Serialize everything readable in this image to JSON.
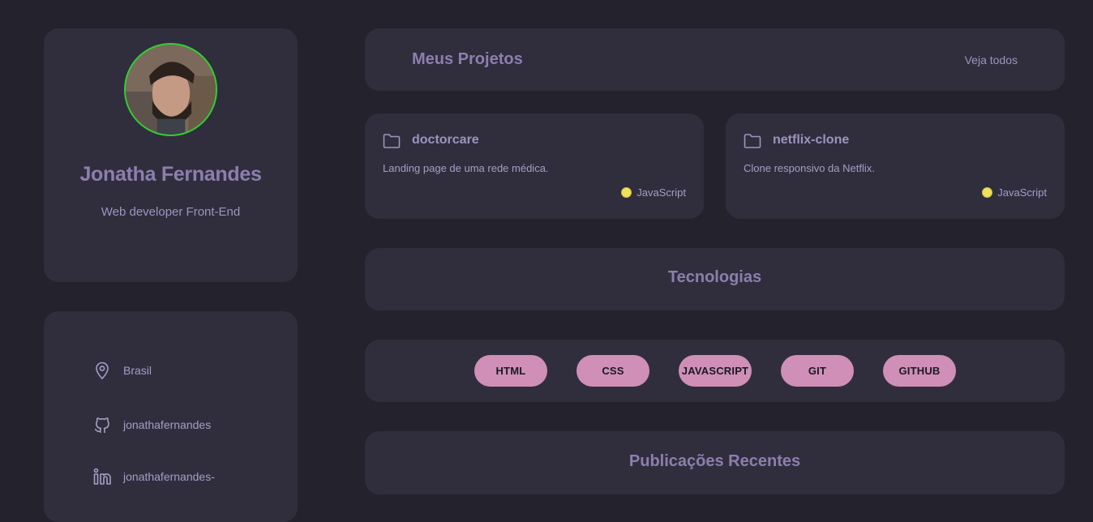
{
  "profile": {
    "name": "Jonatha Fernandes",
    "role": "Web developer Front-End"
  },
  "contacts": [
    {
      "icon": "location-pin-icon",
      "label": "Brasil"
    },
    {
      "icon": "github-icon",
      "label": "jonathafernandes"
    },
    {
      "icon": "linkedin-icon",
      "label": "jonathafernandes-"
    }
  ],
  "projects_section": {
    "title": "Meus Projetos",
    "see_all": "Veja todos"
  },
  "projects": [
    {
      "name": "doctorcare",
      "description": "Landing page de uma rede médica.",
      "language": "JavaScript",
      "language_color": "#f1e05a"
    },
    {
      "name": "netflix-clone",
      "description": "Clone responsivo da Netflix.",
      "language": "JavaScript",
      "language_color": "#f1e05a"
    }
  ],
  "technologies": {
    "title": "Tecnologias",
    "items": [
      "HTML",
      "CSS",
      "JAVASCRIPT",
      "GIT",
      "GITHUB"
    ]
  },
  "publications": {
    "title": "Publicações Recentes"
  },
  "colors": {
    "background": "#24222d",
    "card": "#302e3d",
    "accent_text": "#8c7fae",
    "tag": "#cf8fb6",
    "avatar_border": "#2fd12f"
  }
}
